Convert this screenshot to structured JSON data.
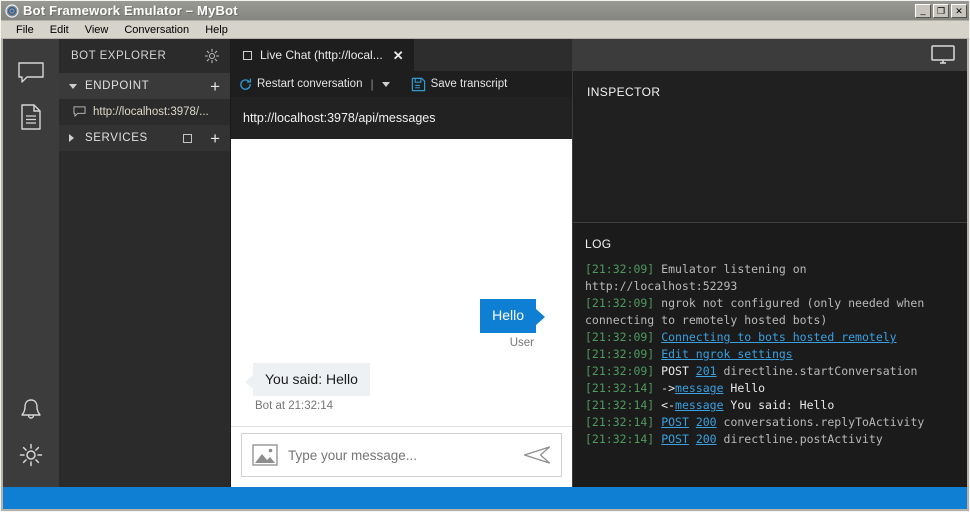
{
  "window": {
    "title": "Bot Framework Emulator – MyBot",
    "icon": "bot-emulator-icon",
    "buttons": {
      "minimize": "_",
      "maximize": "❐",
      "close": "✕"
    }
  },
  "menubar": {
    "items": [
      {
        "label": "File"
      },
      {
        "label": "Edit"
      },
      {
        "label": "View"
      },
      {
        "label": "Conversation"
      },
      {
        "label": "Help"
      }
    ]
  },
  "activitybar": {
    "icons": [
      {
        "name": "chat-icon"
      },
      {
        "name": "document-icon"
      },
      {
        "name": "bell-icon"
      },
      {
        "name": "gear-icon"
      }
    ]
  },
  "explorer": {
    "title": "BOT EXPLORER",
    "settings_icon": "gear-icon",
    "endpoint": {
      "label": "ENDPOINT",
      "expanded": true,
      "add_label": "+",
      "items": [
        {
          "label": "http://localhost:3978/...",
          "icon": "chat-bubble-icon"
        }
      ]
    },
    "services": {
      "label": "SERVICES",
      "expanded": false,
      "add_label": "+"
    }
  },
  "tabs": [
    {
      "label": "Live Chat (http://local...",
      "close_label": "✕",
      "active": true
    }
  ],
  "chat_toolbar": {
    "restart_label": "Restart conversation",
    "restart_icon": "refresh-icon",
    "separator": "|",
    "dropdown_icon": "chevron-down-icon",
    "save_label": "Save transcript",
    "save_icon": "save-icon"
  },
  "endpoint_bar": {
    "url": "http://localhost:3978/api/messages"
  },
  "conversation": {
    "messages": [
      {
        "from": "user",
        "text": "Hello",
        "meta": "User"
      },
      {
        "from": "bot",
        "text": "You said: Hello",
        "meta": "Bot at 21:32:14"
      }
    ]
  },
  "composer": {
    "image_icon": "image-upload-icon",
    "placeholder": "Type your message...",
    "value": "",
    "send_icon": "send-icon"
  },
  "topbar_right": {
    "monitor_icon": "monitor-icon"
  },
  "inspector": {
    "title": "INSPECTOR"
  },
  "log": {
    "title": "LOG",
    "entries": [
      {
        "parts": [
          {
            "type": "ts",
            "text": "[21:32:09]"
          },
          {
            "type": "txt",
            "text": " Emulator listening on http://localhost:52293"
          }
        ]
      },
      {
        "parts": [
          {
            "type": "ts",
            "text": "[21:32:09]"
          },
          {
            "type": "txt",
            "text": " ngrok not configured (only needed when connecting to remotely hosted bots)"
          }
        ]
      },
      {
        "parts": [
          {
            "type": "ts",
            "text": "[21:32:09]"
          },
          {
            "type": "txt",
            "text": " "
          },
          {
            "type": "lnk",
            "text": "Connecting to bots hosted remotely"
          }
        ]
      },
      {
        "parts": [
          {
            "type": "ts",
            "text": "[21:32:09]"
          },
          {
            "type": "txt",
            "text": " "
          },
          {
            "type": "lnk",
            "text": "Edit ngrok settings"
          }
        ]
      },
      {
        "parts": [
          {
            "type": "ts",
            "text": "[21:32:09]"
          },
          {
            "type": "wht",
            "text": " POST "
          },
          {
            "type": "lnk",
            "text": "201"
          },
          {
            "type": "txt",
            "text": " directline.startConversation"
          }
        ]
      },
      {
        "parts": [
          {
            "type": "ts",
            "text": "[21:32:14]"
          },
          {
            "type": "wht",
            "text": " ->"
          },
          {
            "type": "lnk",
            "text": "message"
          },
          {
            "type": "wht",
            "text": " Hello"
          }
        ]
      },
      {
        "parts": [
          {
            "type": "ts",
            "text": "[21:32:14]"
          },
          {
            "type": "wht",
            "text": " <-"
          },
          {
            "type": "lnk",
            "text": "message"
          },
          {
            "type": "wht",
            "text": " You said: Hello"
          }
        ]
      },
      {
        "parts": [
          {
            "type": "ts",
            "text": "[21:32:14]"
          },
          {
            "type": "txt",
            "text": " "
          },
          {
            "type": "lnk",
            "text": "POST"
          },
          {
            "type": "txt",
            "text": " "
          },
          {
            "type": "lnk",
            "text": "200"
          },
          {
            "type": "txt",
            "text": " conversations.replyToActivity"
          }
        ]
      },
      {
        "parts": [
          {
            "type": "ts",
            "text": "[21:32:14]"
          },
          {
            "type": "txt",
            "text": " "
          },
          {
            "type": "lnk",
            "text": "POST"
          },
          {
            "type": "txt",
            "text": " "
          },
          {
            "type": "lnk",
            "text": "200"
          },
          {
            "type": "txt",
            "text": " directline.postActivity"
          }
        ]
      }
    ]
  },
  "colors": {
    "accent": "#0f7fd4",
    "log_timestamp": "#4e9a5f",
    "log_link": "#3aa0e0",
    "titlebar": "#8f8f89"
  }
}
